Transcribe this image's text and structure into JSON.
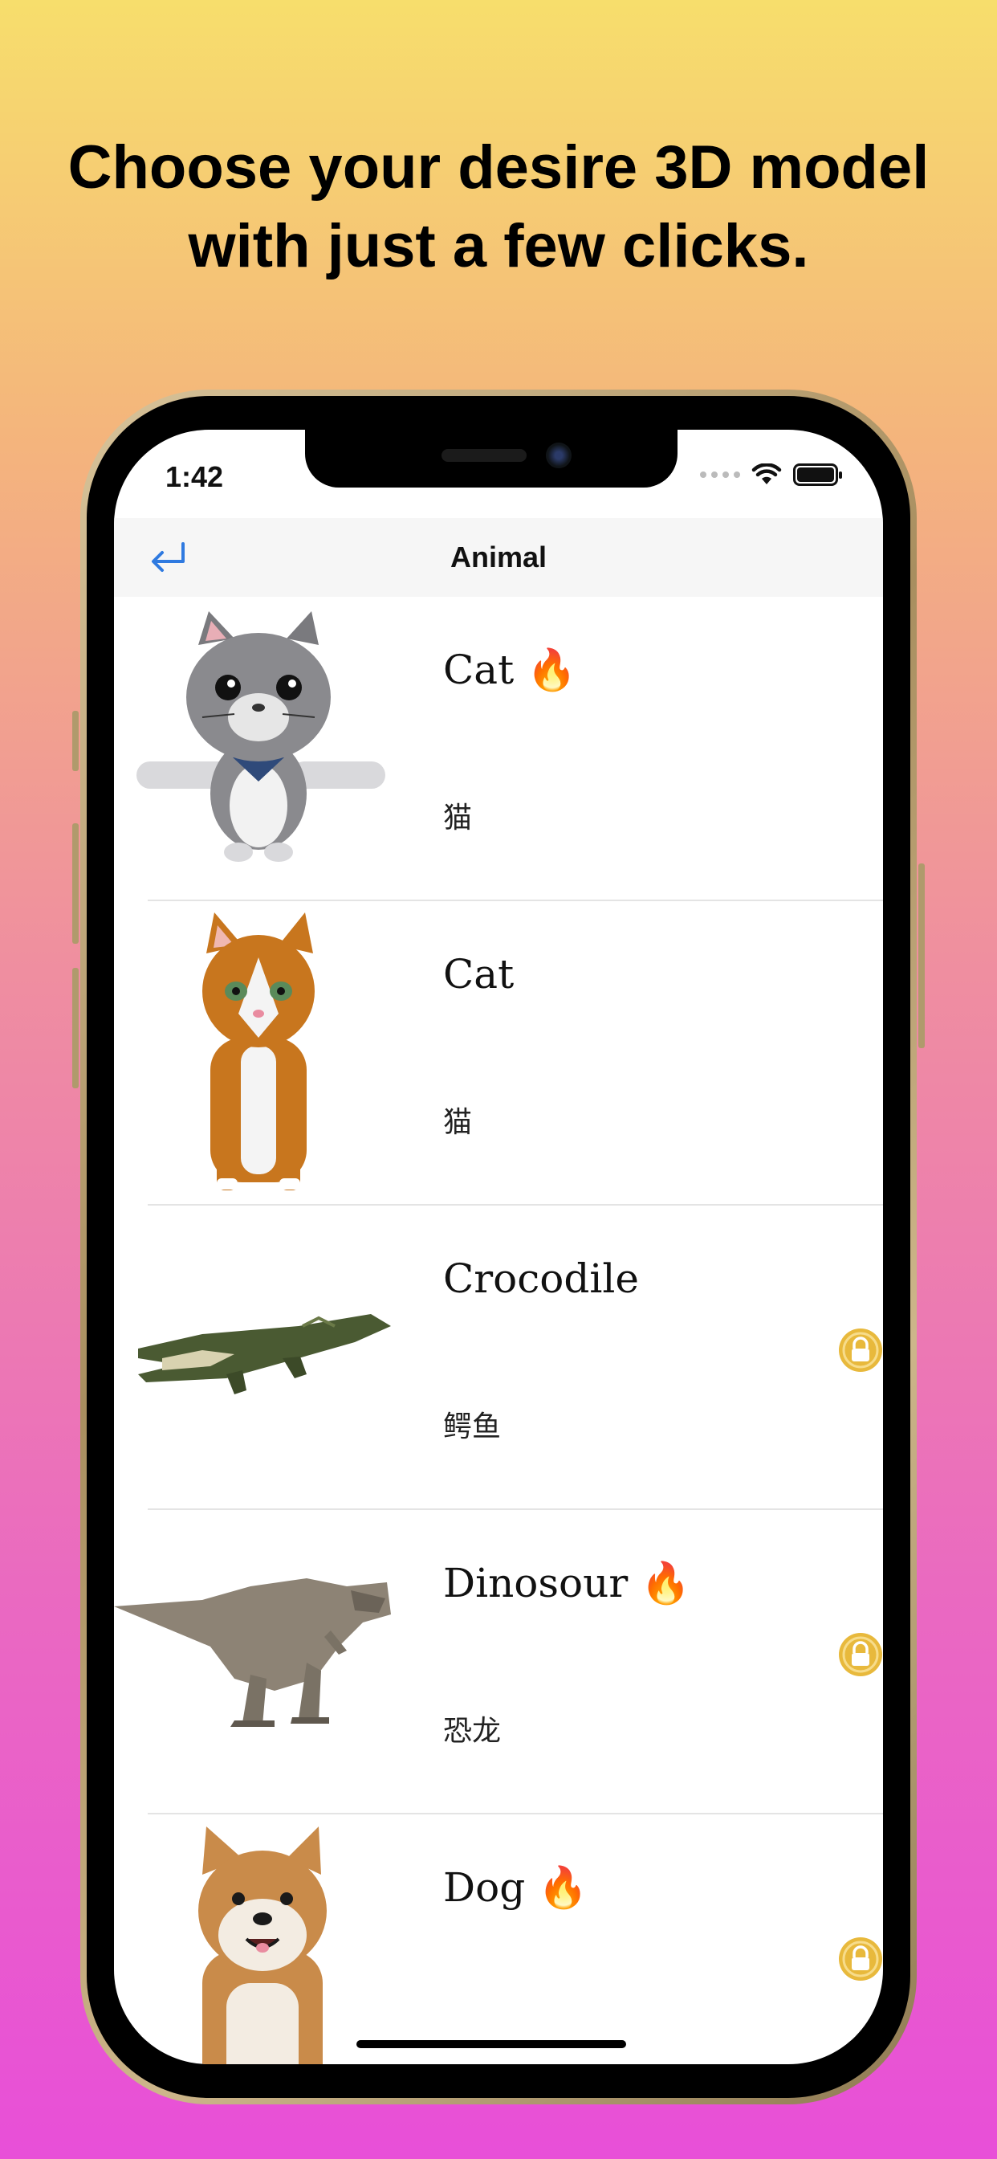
{
  "headline": {
    "line1": "Choose your desire 3D model",
    "line2": "with just a few clicks."
  },
  "status_bar": {
    "time": "1:42"
  },
  "nav": {
    "title": "Animal"
  },
  "items": [
    {
      "title": "Cat 🔥",
      "subtitle": "猫",
      "locked": false,
      "image": "gray-cartoon-cat"
    },
    {
      "title": "Cat",
      "subtitle": "猫",
      "locked": false,
      "image": "orange-cat"
    },
    {
      "title": "Crocodile",
      "subtitle": "鳄鱼",
      "locked": true,
      "image": "crocodile"
    },
    {
      "title": "Dinosour 🔥",
      "subtitle": "恐龙",
      "locked": true,
      "image": "t-rex"
    },
    {
      "title": "Dog 🔥",
      "subtitle": "",
      "locked": true,
      "image": "shiba-dog"
    }
  ],
  "colors": {
    "lock_gold": "#e8b93c",
    "back_blue": "#2f7ae0"
  }
}
